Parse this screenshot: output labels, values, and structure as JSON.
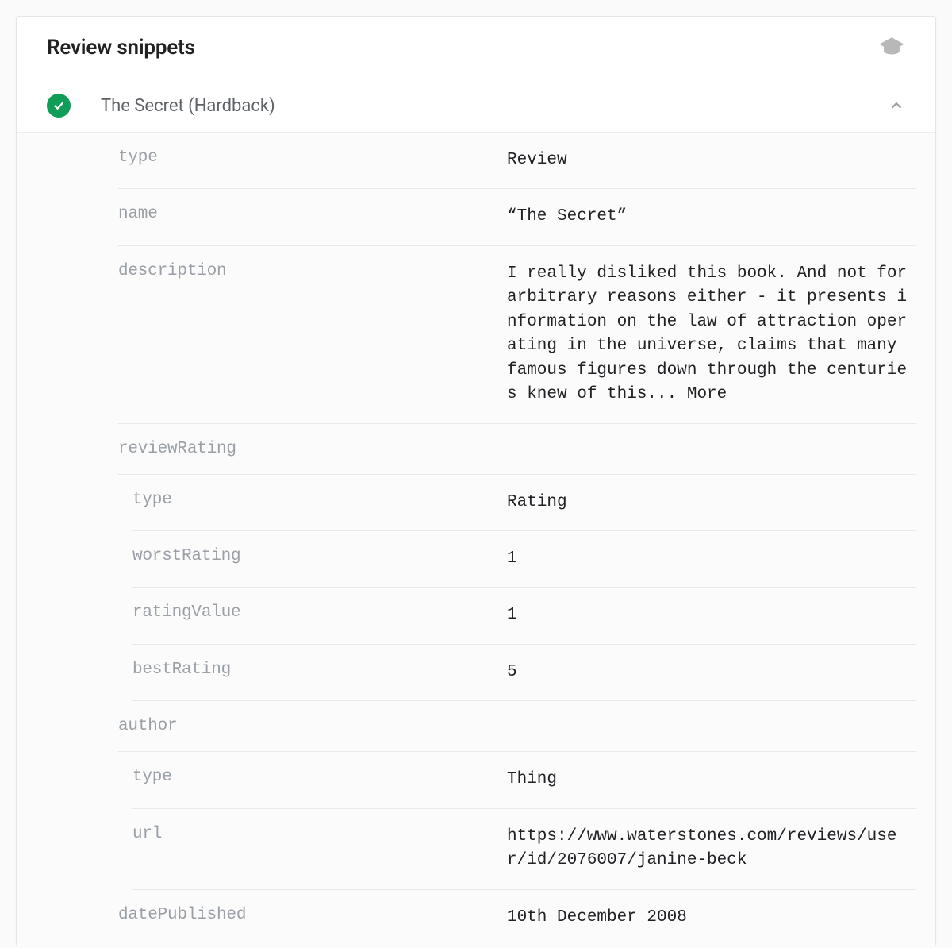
{
  "header": {
    "title": "Review snippets"
  },
  "item": {
    "title": "The Secret (Hardback)"
  },
  "props": {
    "type": {
      "key": "type",
      "val": "Review"
    },
    "name": {
      "key": "name",
      "val": "“The Secret”"
    },
    "description": {
      "key": "description",
      "val": "I really disliked this book. And not for arbitrary reasons either - it presents information on the law of attraction operating in the universe, claims that many famous figures down through the centuries knew of this... More"
    },
    "reviewRating": {
      "key": "reviewRating"
    },
    "rating_type": {
      "key": "type",
      "val": "Rating"
    },
    "worstRating": {
      "key": "worstRating",
      "val": "1"
    },
    "ratingValue": {
      "key": "ratingValue",
      "val": "1"
    },
    "bestRating": {
      "key": "bestRating",
      "val": "5"
    },
    "author": {
      "key": "author"
    },
    "author_type": {
      "key": "type",
      "val": "Thing"
    },
    "url": {
      "key": "url",
      "val": "https://www.waterstones.com/reviews/user/id/2076007/janine-beck"
    },
    "datePublished": {
      "key": "datePublished",
      "val": "10th December 2008"
    }
  }
}
